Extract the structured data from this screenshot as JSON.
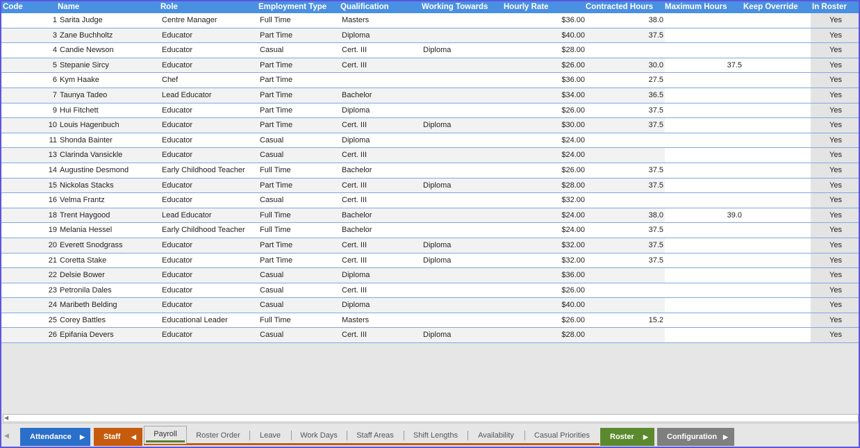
{
  "columns": {
    "code": "Code",
    "name": "Name",
    "role": "Role",
    "employment_type": "Employment Type",
    "qualification": "Qualification",
    "working_towards": "Working Towards",
    "hourly_rate": "Hourly Rate",
    "contracted_hours": "Contracted Hours",
    "maximum_hours": "Maximum Hours",
    "keep_override": "Keep Override",
    "in_roster": "In Roster"
  },
  "rows": [
    {
      "code": "1",
      "name": "Sarita Judge",
      "role": "Centre Manager",
      "employment": "Full Time",
      "qualification": "Masters",
      "working_towards": "",
      "rate": "$36.00",
      "contracted": "38.0",
      "maximum": "",
      "in_roster": "Yes"
    },
    {
      "code": "3",
      "name": "Zane Buchholtz",
      "role": "Educator",
      "employment": "Part Time",
      "qualification": "Diploma",
      "working_towards": "",
      "rate": "$40.00",
      "contracted": "37.5",
      "maximum": "",
      "in_roster": "Yes"
    },
    {
      "code": "4",
      "name": "Candie Newson",
      "role": "Educator",
      "employment": "Casual",
      "qualification": "Cert. III",
      "working_towards": "Diploma",
      "rate": "$28.00",
      "contracted": "",
      "maximum": "",
      "in_roster": "Yes"
    },
    {
      "code": "5",
      "name": "Stepanie Sircy",
      "role": "Educator",
      "employment": "Part Time",
      "qualification": "Cert. III",
      "working_towards": "",
      "rate": "$26.00",
      "contracted": "30.0",
      "maximum": "37.5",
      "in_roster": "Yes"
    },
    {
      "code": "6",
      "name": "Kym Haake",
      "role": "Chef",
      "employment": "Part Time",
      "qualification": "",
      "working_towards": "",
      "rate": "$36.00",
      "contracted": "27.5",
      "maximum": "",
      "in_roster": "Yes"
    },
    {
      "code": "7",
      "name": "Taunya Tadeo",
      "role": "Lead Educator",
      "employment": "Part Time",
      "qualification": "Bachelor",
      "working_towards": "",
      "rate": "$34.00",
      "contracted": "36.5",
      "maximum": "",
      "in_roster": "Yes"
    },
    {
      "code": "9",
      "name": "Hui Fitchett",
      "role": "Educator",
      "employment": "Part Time",
      "qualification": "Diploma",
      "working_towards": "",
      "rate": "$26.00",
      "contracted": "37.5",
      "maximum": "",
      "in_roster": "Yes"
    },
    {
      "code": "10",
      "name": "Louis Hagenbuch",
      "role": "Educator",
      "employment": "Part Time",
      "qualification": "Cert. III",
      "working_towards": "Diploma",
      "rate": "$30.00",
      "contracted": "37.5",
      "maximum": "",
      "in_roster": "Yes"
    },
    {
      "code": "11",
      "name": "Shonda Bainter",
      "role": "Educator",
      "employment": "Casual",
      "qualification": "Diploma",
      "working_towards": "",
      "rate": "$24.00",
      "contracted": "",
      "maximum": "",
      "in_roster": "Yes"
    },
    {
      "code": "13",
      "name": "Clarinda Vansickle",
      "role": "Educator",
      "employment": "Casual",
      "qualification": "Cert. III",
      "working_towards": "",
      "rate": "$24.00",
      "contracted": "",
      "maximum": "",
      "in_roster": "Yes"
    },
    {
      "code": "14",
      "name": "Augustine Desmond",
      "role": "Early Childhood Teacher",
      "employment": "Full Time",
      "qualification": "Bachelor",
      "working_towards": "",
      "rate": "$26.00",
      "contracted": "37.5",
      "maximum": "",
      "in_roster": "Yes"
    },
    {
      "code": "15",
      "name": "Nickolas Stacks",
      "role": "Educator",
      "employment": "Part Time",
      "qualification": "Cert. III",
      "working_towards": "Diploma",
      "rate": "$28.00",
      "contracted": "37.5",
      "maximum": "",
      "in_roster": "Yes"
    },
    {
      "code": "16",
      "name": "Velma Frantz",
      "role": "Educator",
      "employment": "Casual",
      "qualification": "Cert. III",
      "working_towards": "",
      "rate": "$32.00",
      "contracted": "",
      "maximum": "",
      "in_roster": "Yes"
    },
    {
      "code": "18",
      "name": "Trent Haygood",
      "role": "Lead Educator",
      "employment": "Full Time",
      "qualification": "Bachelor",
      "working_towards": "",
      "rate": "$24.00",
      "contracted": "38.0",
      "maximum": "39.0",
      "in_roster": "Yes"
    },
    {
      "code": "19",
      "name": "Melania Hessel",
      "role": "Early Childhood Teacher",
      "employment": "Full Time",
      "qualification": "Bachelor",
      "working_towards": "",
      "rate": "$24.00",
      "contracted": "37.5",
      "maximum": "",
      "in_roster": "Yes"
    },
    {
      "code": "20",
      "name": "Everett Snodgrass",
      "role": "Educator",
      "employment": "Part Time",
      "qualification": "Cert. III",
      "working_towards": "Diploma",
      "rate": "$32.00",
      "contracted": "37.5",
      "maximum": "",
      "in_roster": "Yes"
    },
    {
      "code": "21",
      "name": "Coretta Stake",
      "role": "Educator",
      "employment": "Part Time",
      "qualification": "Cert. III",
      "working_towards": "Diploma",
      "rate": "$32.00",
      "contracted": "37.5",
      "maximum": "",
      "in_roster": "Yes"
    },
    {
      "code": "22",
      "name": "Delsie Bower",
      "role": "Educator",
      "employment": "Casual",
      "qualification": "Diploma",
      "working_towards": "",
      "rate": "$36.00",
      "contracted": "",
      "maximum": "",
      "in_roster": "Yes"
    },
    {
      "code": "23",
      "name": "Petronila Dales",
      "role": "Educator",
      "employment": "Casual",
      "qualification": "Cert. III",
      "working_towards": "",
      "rate": "$26.00",
      "contracted": "",
      "maximum": "",
      "in_roster": "Yes"
    },
    {
      "code": "24",
      "name": "Maribeth Belding",
      "role": "Educator",
      "employment": "Casual",
      "qualification": "Diploma",
      "working_towards": "",
      "rate": "$40.00",
      "contracted": "",
      "maximum": "",
      "in_roster": "Yes"
    },
    {
      "code": "25",
      "name": "Corey Battles",
      "role": "Educational Leader",
      "employment": "Full Time",
      "qualification": "Masters",
      "working_towards": "",
      "rate": "$26.00",
      "contracted": "15.2",
      "maximum": "",
      "in_roster": "Yes"
    },
    {
      "code": "26",
      "name": "Epifania Devers",
      "role": "Educator",
      "employment": "Casual",
      "qualification": "Cert. III",
      "working_towards": "Diploma",
      "rate": "$28.00",
      "contracted": "",
      "maximum": "",
      "in_roster": "Yes"
    }
  ],
  "tabs": {
    "attendance": "Attendance",
    "staff": "Staff",
    "payroll": "Payroll",
    "roster_order": "Roster Order",
    "leave": "Leave",
    "work_days": "Work Days",
    "staff_areas": "Staff Areas",
    "shift_lengths": "Shift Lengths",
    "availability": "Availability",
    "casual_priorities": "Casual Priorities",
    "roster": "Roster",
    "configuration": "Configuration"
  },
  "colors": {
    "header": "#4a90e2",
    "frame": "#5a55e0",
    "attendance_tab": "#2a6fc9",
    "staff_tab": "#c65b0e",
    "roster_tab": "#5b8a2e",
    "configuration_tab": "#7f7f7f"
  }
}
